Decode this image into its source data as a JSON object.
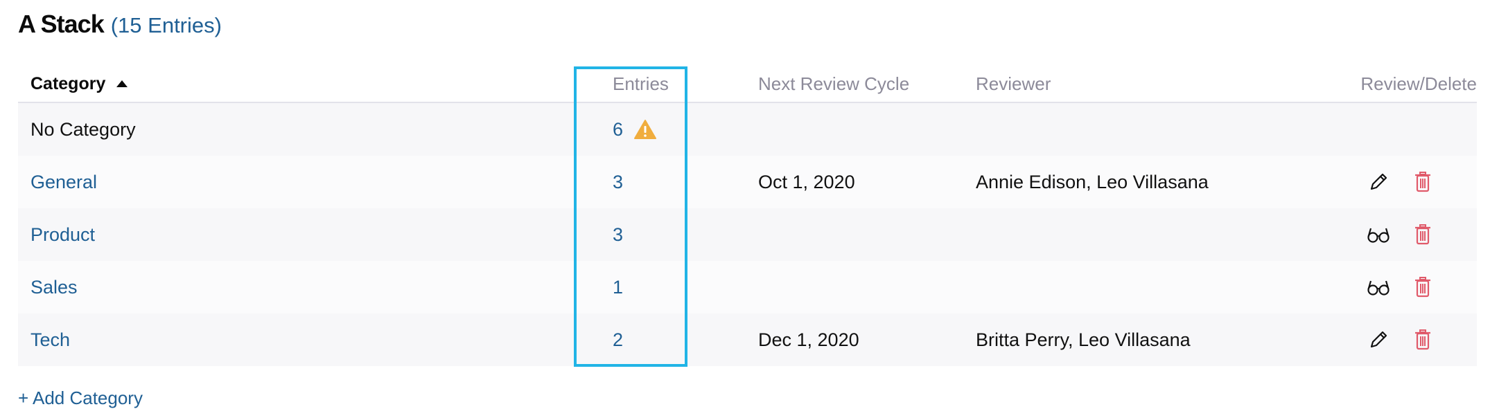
{
  "header": {
    "title": "A Stack",
    "count": "(15 Entries)"
  },
  "table": {
    "columns": {
      "category": "Category",
      "entries": "Entries",
      "next_review": "Next Review Cycle",
      "reviewer": "Reviewer",
      "actions": "Review/Delete"
    },
    "rows": [
      {
        "category": "No Category",
        "entries": "6",
        "next_review": "",
        "reviewer": ""
      },
      {
        "category": "General",
        "entries": "3",
        "next_review": "Oct 1, 2020",
        "reviewer": "Annie Edison, Leo Villasana"
      },
      {
        "category": "Product",
        "entries": "3",
        "next_review": "",
        "reviewer": ""
      },
      {
        "category": "Sales",
        "entries": "1",
        "next_review": "",
        "reviewer": ""
      },
      {
        "category": "Tech",
        "entries": "2",
        "next_review": "Dec 1, 2020",
        "reviewer": "Britta Perry, Leo Villasana"
      }
    ]
  },
  "footer": {
    "add_label": "+ Add Category"
  },
  "colors": {
    "link": "#1f5f94",
    "warning": "#f0ad3e",
    "delete": "#e05a6a",
    "highlight": "#21b4e6"
  },
  "icons": {
    "warning": "warning-icon",
    "edit": "pencil-icon",
    "review": "glasses-icon",
    "delete": "trash-icon"
  }
}
